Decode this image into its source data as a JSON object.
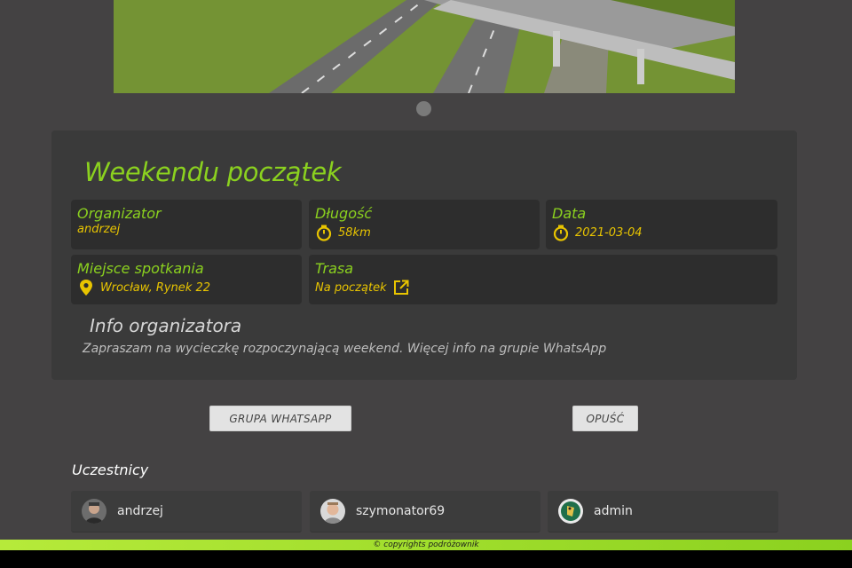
{
  "event": {
    "title": "Weekendu początek",
    "organizer": {
      "label": "Organizator",
      "value": "andrzej"
    },
    "length": {
      "label": "Długość",
      "value": "58km",
      "icon": "stopwatch-icon"
    },
    "date": {
      "label": "Data",
      "value": "2021-03-04",
      "icon": "stopwatch-icon"
    },
    "meeting": {
      "label": "Miejsce spotkania",
      "value": "Wrocław, Rynek 22",
      "icon": "map-pin-icon"
    },
    "route": {
      "label": "Trasa",
      "value": "Na początek",
      "icon": "external-link-icon"
    },
    "info_heading": "Info organizatora",
    "info_text": "Zapraszam na wycieczkę rozpoczynającą weekend. Więcej info na grupie WhatsApp"
  },
  "actions": {
    "whatsapp": "GRUPA WHATSAPP",
    "leave": "OPUŚĆ"
  },
  "participants": {
    "heading": "Uczestnicy",
    "list": [
      {
        "name": "andrzej"
      },
      {
        "name": "szymonator69"
      },
      {
        "name": "admin"
      }
    ]
  },
  "footer": {
    "text": "© copyrights podróżownik"
  },
  "colors": {
    "accent": "#8bd11f",
    "value": "#e8c400",
    "background": "#444243",
    "card": "#3a3a3a",
    "box": "#2d2d2d"
  }
}
